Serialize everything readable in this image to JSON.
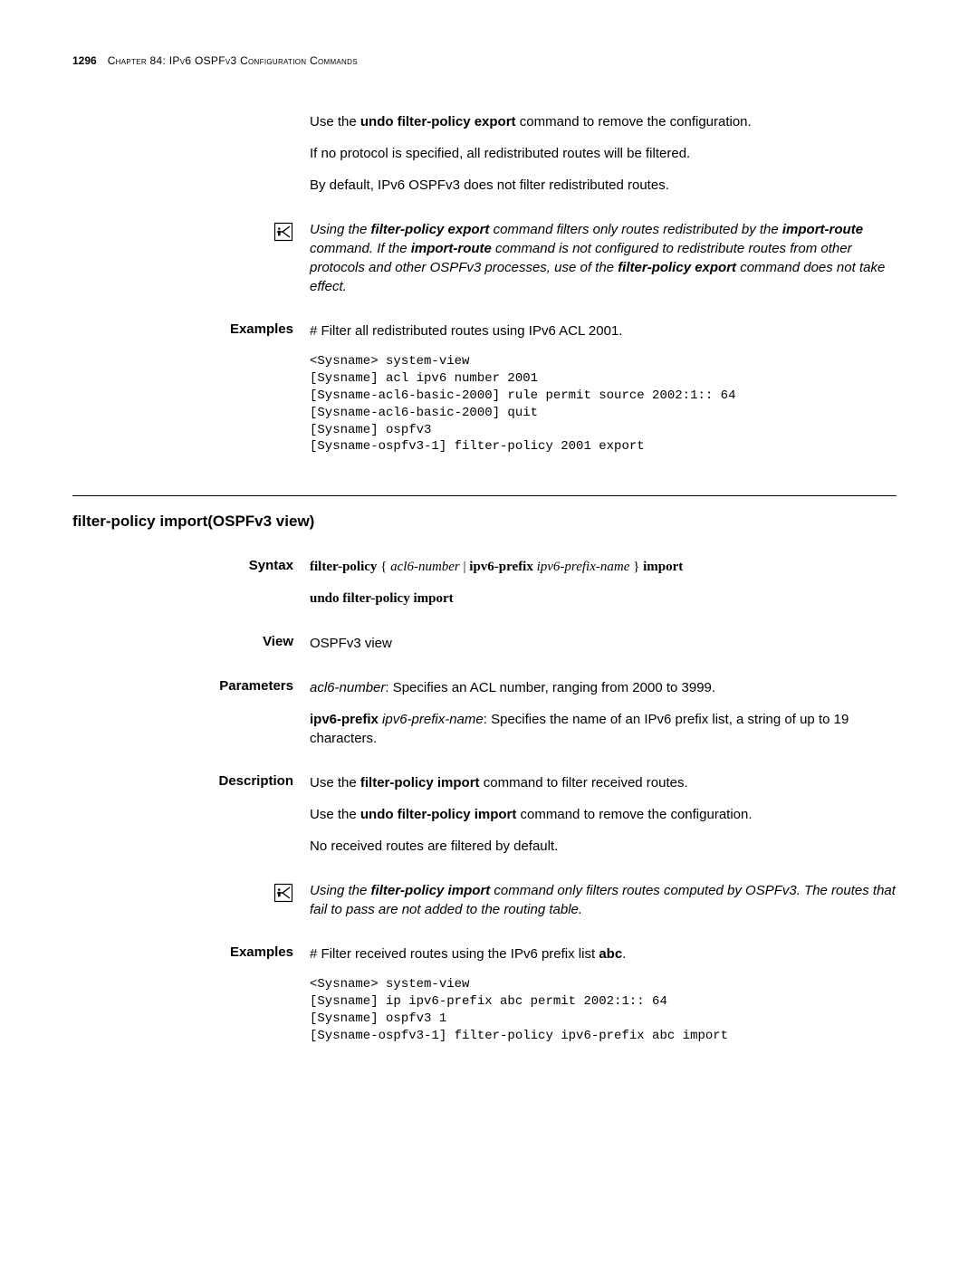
{
  "header": {
    "page_number": "1296",
    "chapter": "Chapter 84: IPv6 OSPFv3 Configuration Commands"
  },
  "upper": {
    "desc_p1_a": "Use the ",
    "desc_p1_b": "undo filter-policy export",
    "desc_p1_c": " command to remove the configuration.",
    "desc_p2": "If no protocol is specified, all redistributed routes will be filtered.",
    "desc_p3": "By default, IPv6 OSPFv3 does not filter redistributed routes.",
    "note_a": "Using the ",
    "note_b": "filter-policy export",
    "note_c": " command filters only routes redistributed by the ",
    "note_d": "import-route",
    "note_e": " command. If the ",
    "note_f": "import-route",
    "note_g": " command is not configured to redistribute routes from other protocols and other OSPFv3 processes, use of the ",
    "note_h": "filter-policy export",
    "note_i": " command does not take effect.",
    "examples_label": "Examples",
    "examples_intro": "# Filter all redistributed routes using IPv6 ACL 2001.",
    "examples_code": "<Sysname> system-view\n[Sysname] acl ipv6 number 2001\n[Sysname-acl6-basic-2000] rule permit source 2002:1:: 64\n[Sysname-acl6-basic-2000] quit\n[Sysname] ospfv3\n[Sysname-ospfv3-1] filter-policy 2001 export"
  },
  "section2": {
    "title": "filter-policy import(OSPFv3 view)",
    "syntax_label": "Syntax",
    "syntax_kw1": "filter-policy",
    "syntax_brace_open": " { ",
    "syntax_arg1": "acl6-number",
    "syntax_pipe": " | ",
    "syntax_kw2": "ipv6-prefix",
    "syntax_sp": " ",
    "syntax_arg2": "ipv6-prefix-name",
    "syntax_brace_close": " } ",
    "syntax_kw3": "import",
    "syntax_undo": "undo filter-policy import",
    "view_label": "View",
    "view_text": "OSPFv3 view",
    "params_label": "Parameters",
    "params_p1_a": "acl6-number",
    "params_p1_b": ": Specifies an ACL number, ranging from 2000 to 3999.",
    "params_p2_a": "ipv6-prefix",
    "params_p2_b": " ",
    "params_p2_c": "ipv6-prefix-name",
    "params_p2_d": ": Specifies the name of an IPv6 prefix list, a string of up to 19 characters.",
    "desc_label": "Description",
    "desc_p1_a": "Use the ",
    "desc_p1_b": "filter-policy import",
    "desc_p1_c": " command to filter received routes.",
    "desc_p2_a": "Use the ",
    "desc_p2_b": "undo filter-policy import",
    "desc_p2_c": " command to remove the configuration.",
    "desc_p3": "No received routes are filtered by default.",
    "note_a": "Using the ",
    "note_b": "filter-policy import",
    "note_c": " command only filters routes computed by OSPFv3. The routes that fail to pass are not added to the routing table.",
    "examples_label": "Examples",
    "examples_intro_a": "# Filter received routes using the IPv6 prefix list ",
    "examples_intro_b": "abc",
    "examples_intro_c": ".",
    "examples_code": "<Sysname> system-view\n[Sysname] ip ipv6-prefix abc permit 2002:1:: 64\n[Sysname] ospfv3 1\n[Sysname-ospfv3-1] filter-policy ipv6-prefix abc import"
  }
}
